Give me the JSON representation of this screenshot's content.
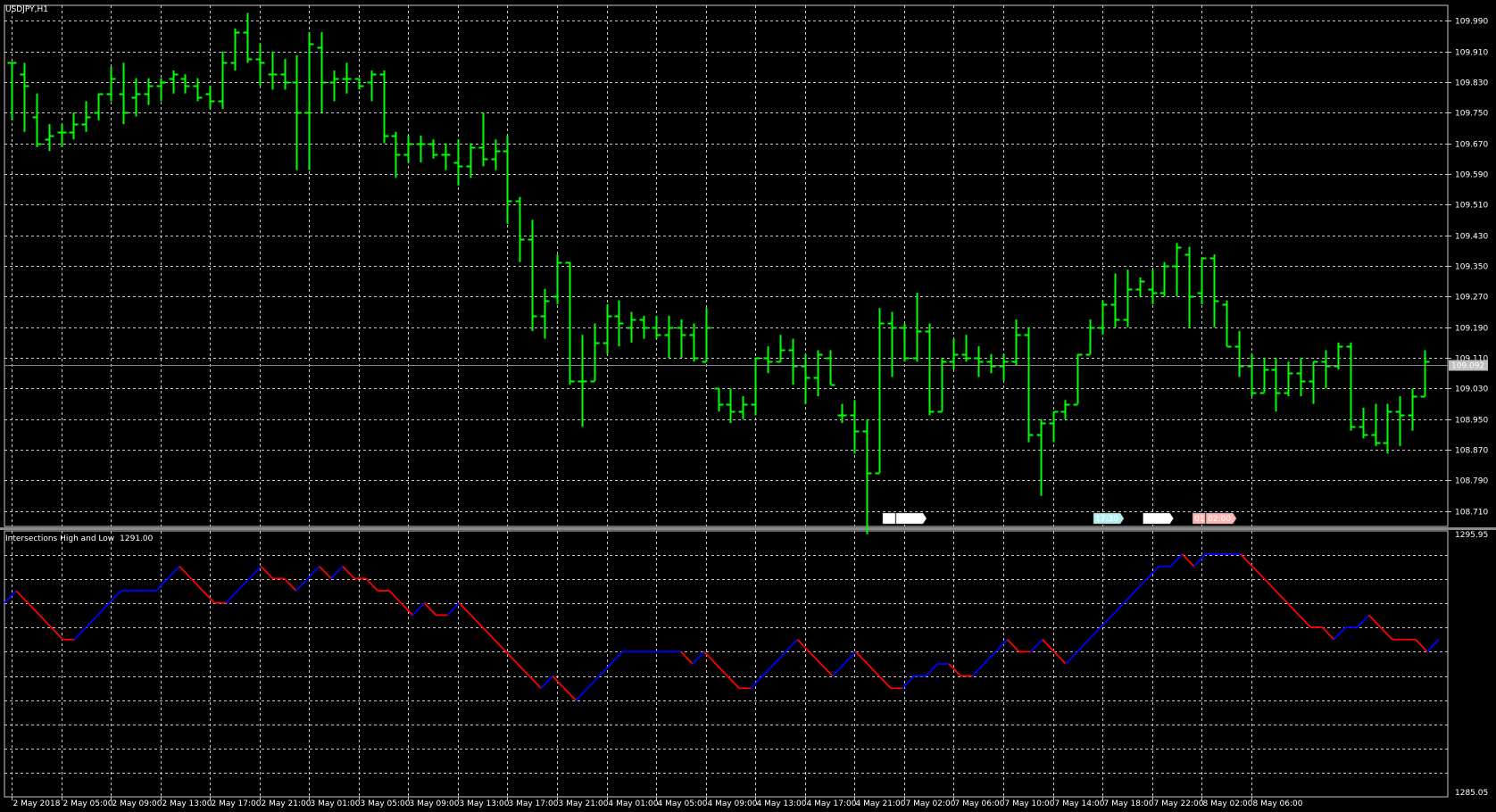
{
  "window": {
    "symbol_label": "USDJPY,H1",
    "current_price": "109.092",
    "price_line_value": 109.092
  },
  "price_panel": {
    "y_ticks": [
      "109.990",
      "109.910",
      "109.830",
      "109.750",
      "109.670",
      "109.590",
      "109.510",
      "109.430",
      "109.350",
      "109.270",
      "109.190",
      "109.110",
      "109.030",
      "108.950",
      "108.870",
      "108.790",
      "108.710"
    ],
    "ylim": [
      108.67,
      110.03
    ],
    "bar_color": "#00ff00",
    "bg_color": "#000000",
    "grid_color": "#c8c8c8",
    "time_markers": [
      {
        "bar": 71,
        "label_a": "01",
        "label_b": "02:00",
        "color": "#ffffff"
      },
      {
        "bar": 88,
        "label_b": "17:30",
        "color": "#b4f0f0"
      },
      {
        "bar": 92,
        "label_b": "21:30",
        "color": "#ffffff"
      },
      {
        "bar": 96,
        "label_a": "01",
        "label_b": "02:00",
        "color": "#ffb4b4"
      }
    ]
  },
  "indicator_panel": {
    "title": "Intersections High and Low",
    "title_value": "1291.00",
    "y_top_label": "1295.95",
    "y_bottom_label": "1285.05",
    "ylim": [
      1285.05,
      1295.95
    ],
    "up_color": "#0000ff",
    "down_color": "#ff0000"
  },
  "x_axis": {
    "labels": [
      "2 May 2018",
      "2 May 05:00",
      "2 May 09:00",
      "2 May 13:00",
      "2 May 17:00",
      "2 May 21:00",
      "3 May 01:00",
      "3 May 05:00",
      "3 May 09:00",
      "3 May 13:00",
      "3 May 17:00",
      "3 May 21:00",
      "4 May 01:00",
      "4 May 05:00",
      "4 May 09:00",
      "4 May 13:00",
      "4 May 17:00",
      "4 May 21:00",
      "7 May 02:00",
      "7 May 06:00",
      "7 May 10:00",
      "7 May 14:00",
      "7 May 18:00",
      "7 May 22:00",
      "8 May 02:00",
      "8 May 06:00"
    ]
  },
  "chart_data": {
    "type": "ohlc",
    "symbol": "USDJPY",
    "timeframe": "H1",
    "ohlc": [
      [
        109.88,
        109.88,
        109.73,
        109.88
      ],
      [
        109.85,
        109.88,
        109.7,
        109.82
      ],
      [
        109.74,
        109.8,
        109.66,
        109.67
      ],
      [
        109.68,
        109.72,
        109.65,
        109.69
      ],
      [
        109.7,
        109.72,
        109.66,
        109.7
      ],
      [
        109.7,
        109.75,
        109.68,
        109.72
      ],
      [
        109.72,
        109.78,
        109.7,
        109.74
      ],
      [
        109.75,
        109.8,
        109.73,
        109.8
      ],
      [
        109.8,
        109.87,
        109.78,
        109.84
      ],
      [
        109.8,
        109.88,
        109.72,
        109.75
      ],
      [
        109.79,
        109.84,
        109.74,
        109.8
      ],
      [
        109.8,
        109.84,
        109.77,
        109.82
      ],
      [
        109.82,
        109.84,
        109.78,
        109.83
      ],
      [
        109.84,
        109.86,
        109.8,
        109.85
      ],
      [
        109.84,
        109.85,
        109.8,
        109.82
      ],
      [
        109.82,
        109.84,
        109.78,
        109.79
      ],
      [
        109.8,
        109.82,
        109.76,
        109.78
      ],
      [
        109.78,
        109.91,
        109.76,
        109.88
      ],
      [
        109.88,
        109.97,
        109.86,
        109.96
      ],
      [
        109.96,
        110.01,
        109.88,
        109.89
      ],
      [
        109.89,
        109.93,
        109.82,
        109.88
      ],
      [
        109.85,
        109.91,
        109.81,
        109.85
      ],
      [
        109.85,
        109.89,
        109.81,
        109.83
      ],
      [
        109.83,
        109.9,
        109.6,
        109.75
      ],
      [
        109.75,
        109.96,
        109.6,
        109.93
      ],
      [
        109.92,
        109.96,
        109.75,
        109.83
      ],
      [
        109.83,
        109.86,
        109.78,
        109.84
      ],
      [
        109.84,
        109.88,
        109.8,
        109.84
      ],
      [
        109.84,
        109.84,
        109.81,
        109.82
      ],
      [
        109.83,
        109.86,
        109.78,
        109.85
      ],
      [
        109.85,
        109.86,
        109.67,
        109.69
      ],
      [
        109.69,
        109.7,
        109.58,
        109.64
      ],
      [
        109.64,
        109.69,
        109.62,
        109.67
      ],
      [
        109.67,
        109.69,
        109.62,
        109.67
      ],
      [
        109.67,
        109.68,
        109.63,
        109.64
      ],
      [
        109.64,
        109.67,
        109.6,
        109.64
      ],
      [
        109.62,
        109.68,
        109.56,
        109.61
      ],
      [
        109.61,
        109.67,
        109.58,
        109.66
      ],
      [
        109.66,
        109.75,
        109.61,
        109.63
      ],
      [
        109.63,
        109.68,
        109.6,
        109.65
      ],
      [
        109.65,
        109.69,
        109.46,
        109.52
      ],
      [
        109.52,
        109.53,
        109.36,
        109.42
      ],
      [
        109.42,
        109.47,
        109.18,
        109.22
      ],
      [
        109.22,
        109.29,
        109.16,
        109.26
      ],
      [
        109.27,
        109.38,
        109.25,
        109.36
      ],
      [
        109.36,
        109.36,
        109.04,
        109.05
      ],
      [
        109.05,
        109.17,
        108.93,
        109.05
      ],
      [
        109.05,
        109.2,
        109.05,
        109.15
      ],
      [
        109.15,
        109.25,
        109.12,
        109.22
      ],
      [
        109.22,
        109.26,
        109.14,
        109.2
      ],
      [
        109.19,
        109.23,
        109.15,
        109.21
      ],
      [
        109.21,
        109.22,
        109.16,
        109.19
      ],
      [
        109.19,
        109.22,
        109.16,
        109.17
      ],
      [
        109.17,
        109.22,
        109.11,
        109.19
      ],
      [
        109.19,
        109.21,
        109.11,
        109.17
      ],
      [
        109.17,
        109.2,
        109.1,
        109.11
      ],
      [
        109.1,
        109.24,
        109.1,
        109.19
      ],
      [
        109.03,
        109.03,
        108.97,
        108.99
      ],
      [
        108.99,
        109.03,
        108.94,
        108.97
      ],
      [
        108.97,
        109.01,
        108.95,
        108.99
      ],
      [
        108.99,
        109.11,
        108.96,
        109.11
      ],
      [
        109.11,
        109.14,
        109.07,
        109.1
      ],
      [
        109.1,
        109.17,
        109.1,
        109.13
      ],
      [
        109.13,
        109.16,
        109.04,
        109.09
      ],
      [
        109.09,
        109.12,
        108.99,
        109.06
      ],
      [
        109.06,
        109.13,
        109.01,
        109.12
      ],
      [
        109.11,
        109.13,
        109.04,
        109.04
      ],
      [
        108.96,
        108.99,
        108.94,
        108.96
      ],
      [
        108.96,
        109.0,
        108.86,
        108.92
      ],
      [
        108.92,
        108.95,
        108.65,
        108.81
      ],
      [
        108.81,
        109.24,
        108.81,
        109.2
      ],
      [
        109.2,
        109.23,
        109.06,
        109.19
      ],
      [
        109.19,
        109.2,
        109.1,
        109.11
      ],
      [
        109.11,
        109.28,
        109.1,
        109.18
      ],
      [
        109.18,
        109.2,
        108.96,
        108.97
      ],
      [
        108.97,
        109.11,
        108.97,
        109.1
      ],
      [
        109.1,
        109.16,
        109.08,
        109.12
      ],
      [
        109.12,
        109.17,
        109.1,
        109.11
      ],
      [
        109.11,
        109.14,
        109.06,
        109.1
      ],
      [
        109.1,
        109.12,
        109.07,
        109.09
      ],
      [
        109.09,
        109.12,
        109.05,
        109.1
      ],
      [
        109.1,
        109.21,
        109.09,
        109.17
      ],
      [
        109.17,
        109.19,
        108.89,
        108.91
      ],
      [
        108.91,
        108.95,
        108.75,
        108.94
      ],
      [
        108.94,
        108.97,
        108.89,
        108.97
      ],
      [
        108.97,
        109.0,
        108.95,
        108.99
      ],
      [
        108.99,
        109.12,
        108.99,
        109.12
      ],
      [
        109.12,
        109.21,
        109.12,
        109.19
      ],
      [
        109.19,
        109.26,
        109.17,
        109.25
      ],
      [
        109.25,
        109.33,
        109.19,
        109.21
      ],
      [
        109.21,
        109.34,
        109.19,
        109.29
      ],
      [
        109.29,
        109.32,
        109.27,
        109.31
      ],
      [
        109.29,
        109.34,
        109.25,
        109.28
      ],
      [
        109.28,
        109.36,
        109.27,
        109.35
      ],
      [
        109.35,
        109.41,
        109.27,
        109.4
      ],
      [
        109.38,
        109.4,
        109.19,
        109.27
      ],
      [
        109.28,
        109.37,
        109.25,
        109.37
      ],
      [
        109.37,
        109.38,
        109.19,
        109.26
      ],
      [
        109.25,
        109.26,
        109.14,
        109.14
      ],
      [
        109.14,
        109.18,
        109.06,
        109.09
      ],
      [
        109.09,
        109.12,
        109.01,
        109.02
      ],
      [
        109.02,
        109.11,
        109.02,
        109.08
      ],
      [
        109.08,
        109.11,
        108.97,
        109.02
      ],
      [
        109.02,
        109.1,
        109.01,
        109.07
      ],
      [
        109.07,
        109.11,
        109.01,
        109.05
      ],
      [
        109.05,
        109.1,
        108.99,
        109.1
      ],
      [
        109.1,
        109.13,
        109.03,
        109.09
      ],
      [
        109.09,
        109.15,
        109.08,
        109.14
      ],
      [
        109.14,
        109.15,
        108.92,
        108.93
      ],
      [
        108.93,
        108.98,
        108.9,
        108.91
      ],
      [
        108.91,
        108.99,
        108.88,
        108.89
      ],
      [
        108.89,
        108.99,
        108.86,
        108.97
      ],
      [
        108.97,
        109.01,
        108.88,
        108.96
      ],
      [
        108.96,
        109.03,
        108.92,
        109.01
      ],
      [
        109.01,
        109.13,
        109.01,
        109.1
      ]
    ],
    "indicator": {
      "name": "Intersections High and Low",
      "values": [
        1293,
        1293.5,
        1293,
        1292.5,
        1292,
        1291.5,
        1291.5,
        1292,
        1292.5,
        1293,
        1293.5,
        1293.5,
        1293.5,
        1293.5,
        1294,
        1294.5,
        1294,
        1293.5,
        1293,
        1293,
        1293.5,
        1294,
        1294.5,
        1294,
        1294,
        1293.5,
        1294,
        1294.5,
        1294,
        1294.5,
        1294,
        1294,
        1293.5,
        1293.5,
        1293,
        1292.5,
        1293,
        1292.5,
        1292.5,
        1293,
        1292.5,
        1292,
        1291.5,
        1291,
        1290.5,
        1290,
        1289.5,
        1290,
        1289.5,
        1289,
        1289.5,
        1290,
        1290.5,
        1291,
        1291,
        1291,
        1291,
        1291,
        1291,
        1290.5,
        1291,
        1290.5,
        1290,
        1289.5,
        1289.5,
        1290,
        1290.5,
        1291,
        1291.5,
        1291,
        1290.5,
        1290,
        1290.5,
        1291,
        1290.5,
        1290,
        1289.5,
        1289.5,
        1290,
        1290,
        1290.5,
        1290.5,
        1290,
        1290,
        1290.5,
        1291,
        1291.5,
        1291,
        1291,
        1291.5,
        1291,
        1290.5,
        1291,
        1291.5,
        1292,
        1292.5,
        1293,
        1293.5,
        1294,
        1294.5,
        1294.5,
        1295,
        1294.5,
        1295,
        1295,
        1295,
        1295,
        1294.5,
        1294,
        1293.5,
        1293,
        1292.5,
        1292,
        1292,
        1291.5,
        1292,
        1292,
        1292.5,
        1292,
        1291.5,
        1291.5,
        1291.5,
        1291,
        1291.5
      ]
    }
  }
}
